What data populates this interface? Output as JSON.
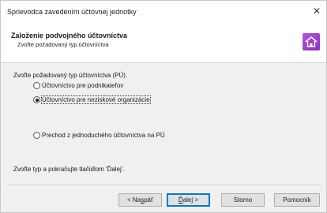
{
  "window": {
    "title": "Sprievodca zavedením účtovnej jednotky",
    "close_glyph": "✕"
  },
  "header": {
    "title": "Založenie podvojného účtovníctva",
    "subtitle": "Zvoľte požadovaný typ účtovníctva",
    "icon": "house-icon",
    "icon_color": "#9b44cf"
  },
  "body": {
    "prompt": "Zvoľte požadovaný typ účtovníctva (PÚ).",
    "options": [
      {
        "label": "Účtovníctvo pre podnikateľov",
        "selected": false
      },
      {
        "label": "Účtovníctvo pre neziskové organizácie",
        "selected": true
      },
      {
        "label": "Prechod z jednoduchého účtovníctva na PÚ",
        "selected": false
      }
    ],
    "instruction": "Zvoľte typ a pokračujte tlačidlom 'Ďalej'."
  },
  "buttons": {
    "back": {
      "pre": "< Na",
      "key": "s",
      "post": "päť"
    },
    "next": {
      "pre": "",
      "key": "Ď",
      "post": "alej >"
    },
    "cancel": "Storno",
    "help": "Pomocník"
  }
}
